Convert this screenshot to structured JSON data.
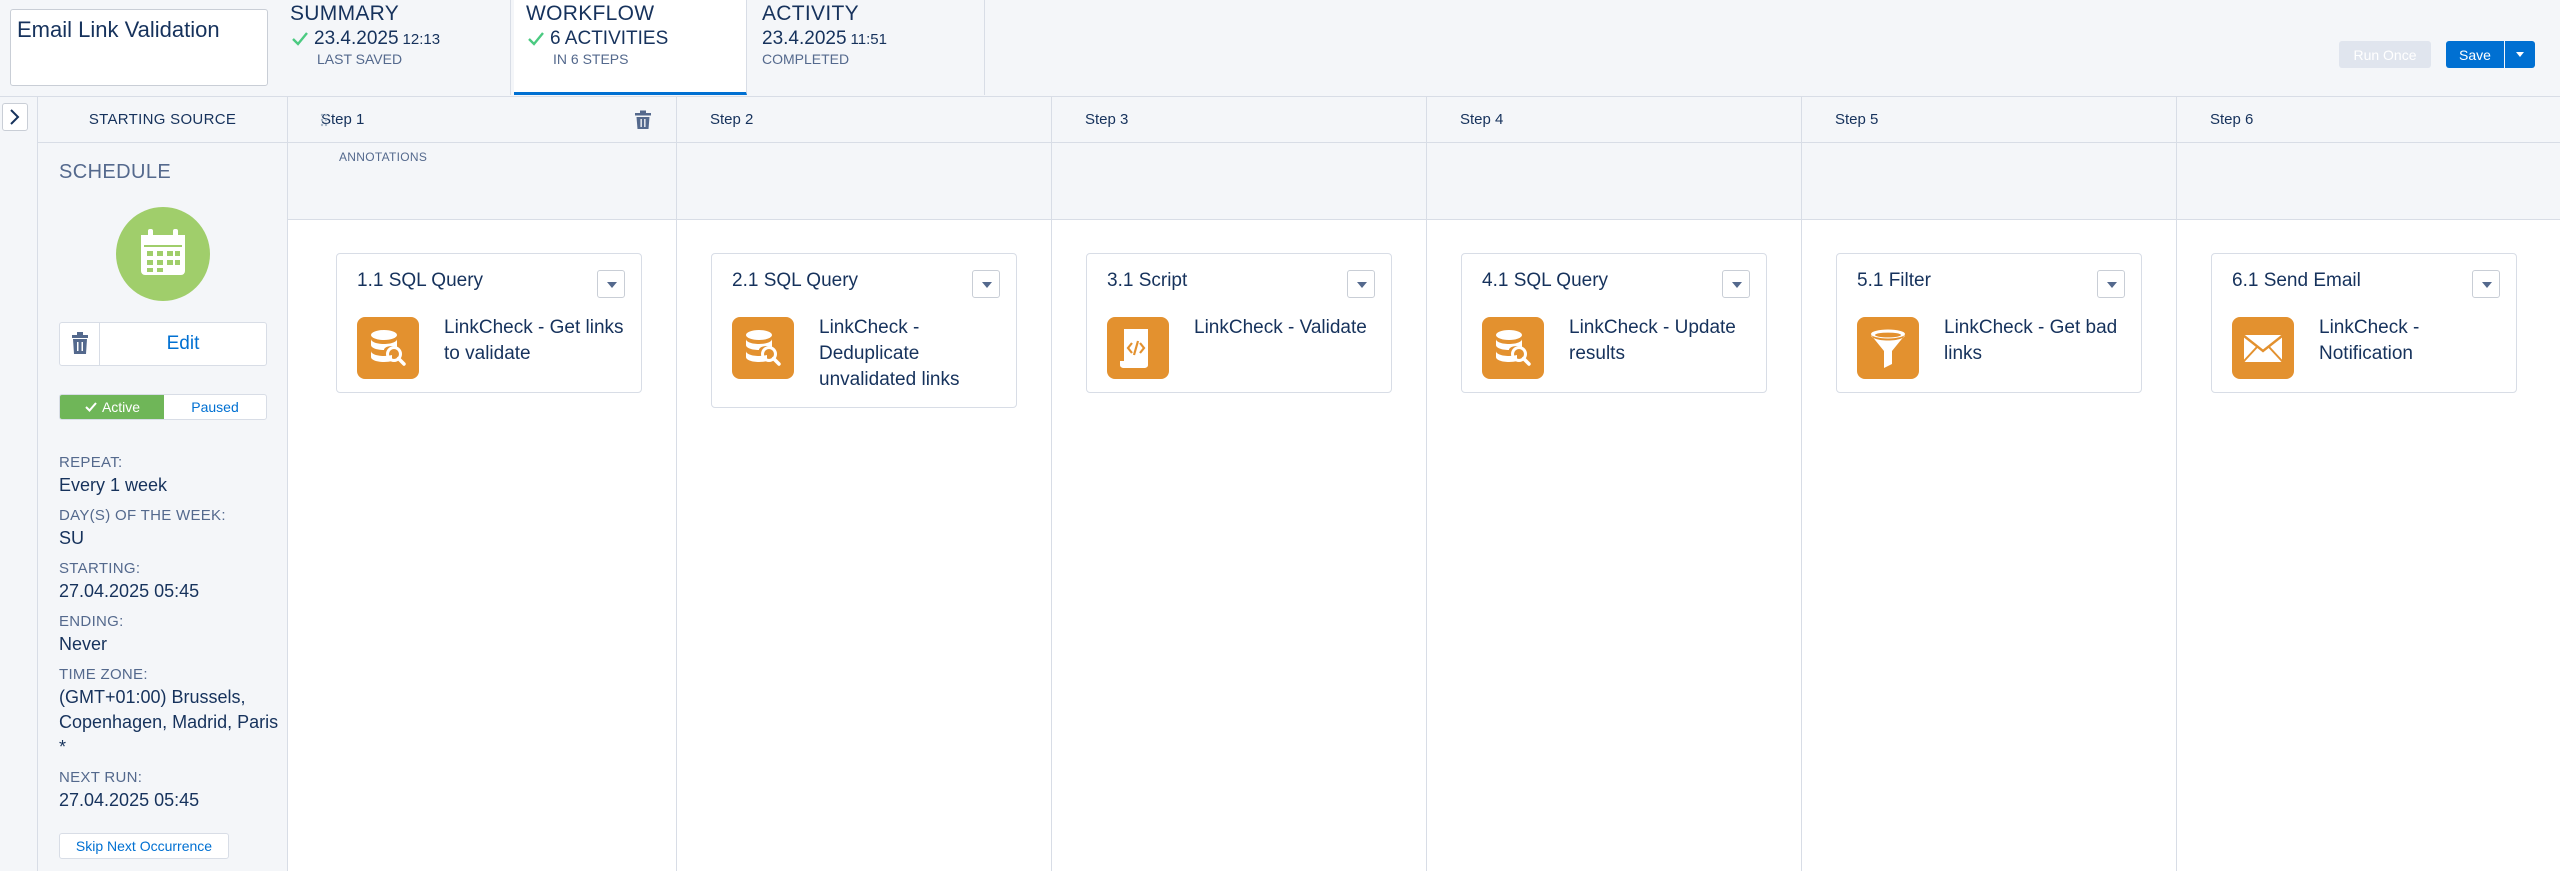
{
  "header": {
    "activity_name": "Email Link Validation",
    "tabs": [
      {
        "title": "SUMMARY",
        "value": "23.4.2025",
        "value_small": "12:13",
        "sub": "LAST SAVED"
      },
      {
        "title": "WORKFLOW",
        "value": "6 ACTIVITIES",
        "value_small": "",
        "sub": "IN 6 STEPS"
      },
      {
        "title": "ACTIVITY",
        "value": "23.4.2025",
        "value_small": "11:51",
        "sub": "COMPLETED"
      }
    ],
    "run_once_label": "Run Once",
    "save_label": "Save"
  },
  "source": {
    "heading": "STARTING SOURCE",
    "schedule_title": "SCHEDULE",
    "edit_label": "Edit",
    "active_label": "Active",
    "paused_label": "Paused",
    "details": [
      {
        "label": "REPEAT:",
        "value": "Every 1 week"
      },
      {
        "label": "DAY(S) OF THE WEEK:",
        "value": "SU"
      },
      {
        "label": "STARTING:",
        "value": "27.04.2025 05:45"
      },
      {
        "label": "ENDING:",
        "value": "Never"
      },
      {
        "label": "TIME ZONE:",
        "value": "(GMT+01:00) Brussels, Copenhagen, Madrid, Paris *"
      },
      {
        "label": "NEXT RUN:",
        "value": "27.04.2025 05:45"
      }
    ],
    "skip_label": "Skip Next Occurrence"
  },
  "annotations_label": "ANNOTATIONS",
  "steps": [
    {
      "label": "Step 1",
      "activity_title": "1.1 SQL Query",
      "activity_name": "LinkCheck - Get links to validate",
      "icon": "sql-query-icon"
    },
    {
      "label": "Step 2",
      "activity_title": "2.1 SQL Query",
      "activity_name": "LinkCheck - Deduplicate unvalidated links",
      "icon": "sql-query-icon"
    },
    {
      "label": "Step 3",
      "activity_title": "3.1 Script",
      "activity_name": "LinkCheck - Validate",
      "icon": "script-icon"
    },
    {
      "label": "Step 4",
      "activity_title": "4.1 SQL Query",
      "activity_name": "LinkCheck - Update results",
      "icon": "sql-query-icon"
    },
    {
      "label": "Step 5",
      "activity_title": "5.1 Filter",
      "activity_name": "LinkCheck - Get bad links",
      "icon": "filter-icon"
    },
    {
      "label": "Step 6",
      "activity_title": "6.1 Send Email",
      "activity_name": "LinkCheck - Notification",
      "icon": "email-icon"
    }
  ],
  "colors": {
    "brand": "#0070d2",
    "activity_icon": "#e3912f",
    "schedule_icon": "#a0ce6b",
    "active_toggle": "#6fb658",
    "text": "#16325c"
  }
}
